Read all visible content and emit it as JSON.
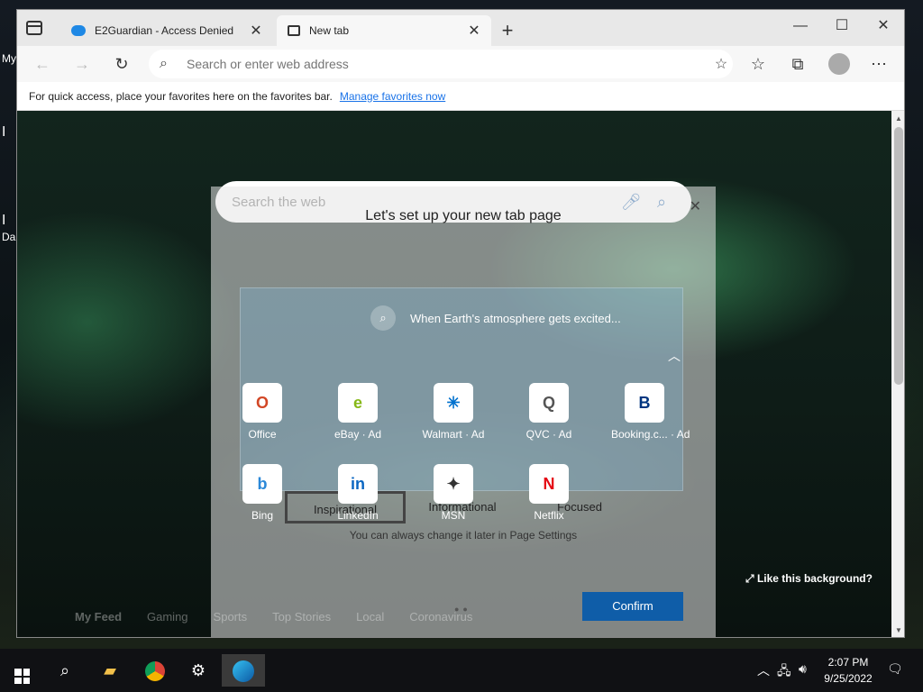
{
  "desktop": {
    "labels": [
      "My",
      "I",
      "I",
      "Da"
    ]
  },
  "browser": {
    "tabs": [
      {
        "title": "E2Guardian - Access Denied"
      },
      {
        "title": "New tab"
      }
    ],
    "address_placeholder": "Search or enter web address",
    "favbar": {
      "text": "For quick access, place your favorites here on the favorites bar.",
      "link": "Manage favorites now"
    }
  },
  "newtab": {
    "search_placeholder": "Search the web",
    "headline": "When Earth's atmosphere gets excited...",
    "tiles": [
      {
        "label": "Office",
        "icon": "O",
        "color": "#d24726"
      },
      {
        "label": "eBay · Ad",
        "icon": "e",
        "color": "#86b817"
      },
      {
        "label": "Walmart · Ad",
        "icon": "✳",
        "color": "#0071ce"
      },
      {
        "label": "QVC · Ad",
        "icon": "Q",
        "color": "#555555"
      },
      {
        "label": "Booking.c... · Ad",
        "icon": "B",
        "color": "#003580"
      },
      {
        "label": "Bing",
        "icon": "b",
        "color": "#2b88d8"
      },
      {
        "label": "LinkedIn",
        "icon": "in",
        "color": "#0a66c2"
      },
      {
        "label": "MSN",
        "icon": "✦",
        "color": "#333333"
      },
      {
        "label": "Netflix",
        "icon": "N",
        "color": "#e50914"
      }
    ],
    "like_background": "Like this background?",
    "feed_tabs": [
      "My Feed",
      "Gaming",
      "Sports",
      "Top Stories",
      "Local",
      "Coronavirus"
    ]
  },
  "dialog": {
    "title": "Let's set up your new tab page",
    "options": [
      "Inspirational",
      "Informational",
      "Focused"
    ],
    "selected": "Inspirational",
    "note": "You can always change it later in Page Settings",
    "confirm": "Confirm"
  },
  "taskbar": {
    "time": "2:07 PM",
    "date": "9/25/2022"
  }
}
